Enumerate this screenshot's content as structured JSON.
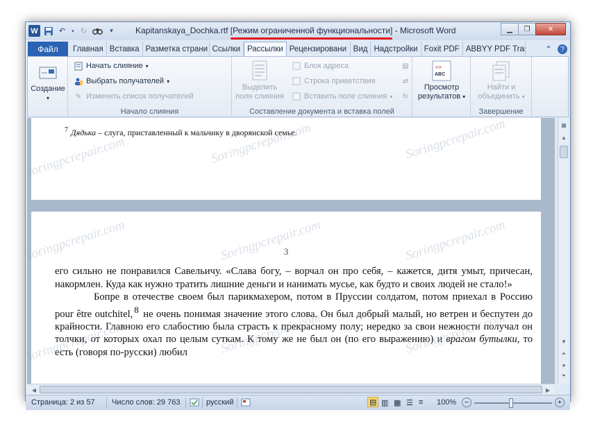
{
  "window": {
    "title_file": "Kapitanskaya_Dochka.rtf",
    "title_mode": "[Режим ограниченной функциональности]",
    "title_sep": " - ",
    "title_app": "Microsoft Word"
  },
  "tabs": {
    "file": "Файл",
    "items": [
      "Главная",
      "Вставка",
      "Разметка страни",
      "Ссылки",
      "Рассылки",
      "Рецензировани",
      "Вид",
      "Надстройки",
      "Foxit PDF",
      "ABBYY PDF Trans"
    ]
  },
  "ribbon": {
    "create": {
      "label": "Создание"
    },
    "start_merge": {
      "start_label": "Начать слияние",
      "select_label": "Выбрать получателей",
      "edit_label": "Изменить список получателей",
      "group_label": "Начало слияния"
    },
    "compose": {
      "highlight_label_1": "Выделить",
      "highlight_label_2": "поля слияния",
      "address_label": "Блок адреса",
      "greeting_label": "Строка приветствия",
      "insert_field_label": "Вставить поле слияния",
      "group_label": "Составление документа и вставка полей"
    },
    "preview": {
      "label_1": "Просмотр",
      "label_2": "результатов",
      "icon_text": "ABC"
    },
    "finish": {
      "label_1": "Найти и",
      "label_2": "объединить",
      "group_label": "Завершение"
    }
  },
  "document": {
    "footnote_num": "7",
    "footnote_term": "Дядька",
    "footnote_rest": " – слуга, приставленный к мальчику в дворянской семье.",
    "page_number": "3",
    "para1": "его сильно не понравился Савельичу. «Слава богу, – ворчал он про себя, – кажется, дитя умыт, причесан, накормлен. Куда как нужно тратить лишние деньги и нанимать мусье, как будто и своих людей не стало!»",
    "para2_a": "Бопре в отечестве своем был парикмахером, потом в Пруссии солдатом, потом приехал в Россию pour être outchitel,",
    "para2_sup": "8",
    "para2_b": " не очень понимая значение этого слова. Он был добрый малый, но ветрен и беспутен до крайности. Главною его слабостию была страсть к прекрасному полу; нередко за свои нежности получал он толчки, от которых охал по целым суткам. К тому же не был он (по его выражению) и ",
    "para2_italic": "врагом бутылки",
    "para2_c": ", то есть (говоря по-русски) любил",
    "watermark": "Soringpcrepair.com"
  },
  "statusbar": {
    "page": "Страница: 2 из 57",
    "words": "Число слов: 29 763",
    "language": "русский",
    "zoom": "100%"
  },
  "colors": {
    "accent": "#2a62b4",
    "highlight_underline": "#e8141b"
  }
}
